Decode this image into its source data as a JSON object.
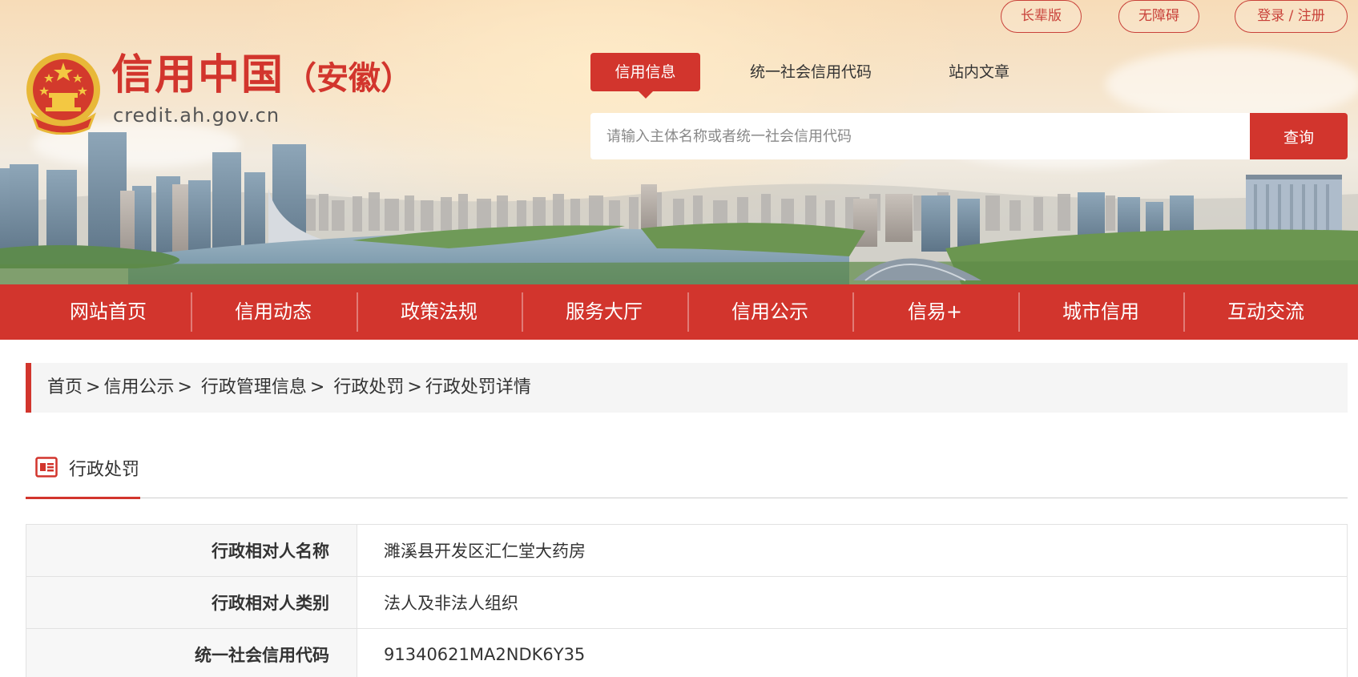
{
  "top_links": [
    {
      "label": "长辈版"
    },
    {
      "label": "无障碍"
    },
    {
      "label": "登录 / 注册"
    }
  ],
  "logo": {
    "title": "信用中国",
    "region": "（安徽）",
    "url": "credit.ah.gov.cn"
  },
  "search": {
    "tabs": [
      {
        "label": "信用信息",
        "active": true
      },
      {
        "label": "统一社会信用代码",
        "active": false
      },
      {
        "label": "站内文章",
        "active": false
      }
    ],
    "placeholder": "请输入主体名称或者统一社会信用代码",
    "button_label": "查询"
  },
  "nav": {
    "items": [
      {
        "label": "网站首页"
      },
      {
        "label": "信用动态"
      },
      {
        "label": "政策法规"
      },
      {
        "label": "服务大厅"
      },
      {
        "label": "信用公示"
      },
      {
        "label": "信易+"
      },
      {
        "label": "城市信用"
      },
      {
        "label": "互动交流"
      }
    ]
  },
  "breadcrumb": {
    "items": [
      "首页",
      "信用公示",
      "行政管理信息",
      "行政处罚",
      "行政处罚详情"
    ],
    "separator": ">"
  },
  "section": {
    "title": "行政处罚",
    "icon": "news-icon"
  },
  "details": {
    "rows": [
      {
        "label": "行政相对人名称",
        "value": "濉溪县开发区汇仁堂大药房"
      },
      {
        "label": "行政相对人类别",
        "value": "法人及非法人组织"
      },
      {
        "label": "统一社会信用代码",
        "value": "91340621MA2NDK6Y35"
      }
    ]
  },
  "colors": {
    "brand_red": "#d2352d",
    "breadcrumb_bg": "#f5f5f5",
    "label_bg": "#f7f7f7"
  }
}
